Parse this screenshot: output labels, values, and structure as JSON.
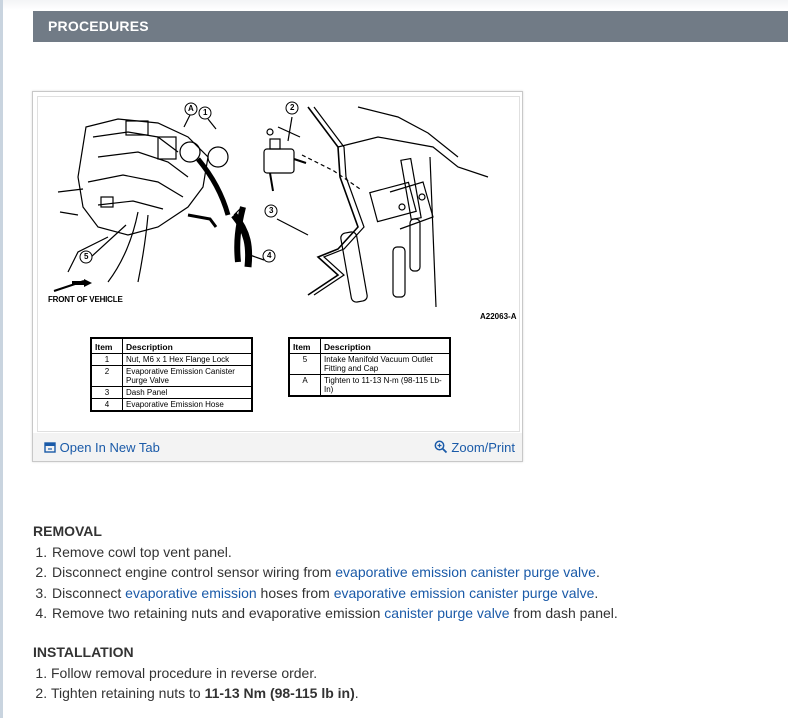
{
  "section": {
    "title": "PROCEDURES"
  },
  "figure": {
    "callouts": {
      "a": "A",
      "one": "1",
      "two": "2",
      "three": "3",
      "four": "4",
      "five": "5"
    },
    "front_label": "FRONT OF VEHICLE",
    "figure_id": "A22063-A",
    "table_left": {
      "headers": [
        "Item",
        "Description"
      ],
      "rows": [
        {
          "item": "1",
          "desc": "Nut, M6 x 1 Hex Flange Lock"
        },
        {
          "item": "2",
          "desc": "Evaporative Emission Canister Purge Valve"
        },
        {
          "item": "3",
          "desc": "Dash Panel"
        },
        {
          "item": "4",
          "desc": "Evaporative Emission Hose"
        }
      ]
    },
    "table_right": {
      "headers": [
        "Item",
        "Description"
      ],
      "rows": [
        {
          "item": "5",
          "desc": "Intake Manifold Vacuum Outlet Fitting and Cap"
        },
        {
          "item": "A",
          "desc": "Tighten to 11-13 N-m (98-115 Lb-In)"
        }
      ]
    },
    "open_new_tab": "Open In New Tab",
    "zoom_print": "Zoom/Print"
  },
  "removal": {
    "heading": "REMOVAL",
    "step1": "Remove cowl top vent panel.",
    "step2_text": "Disconnect engine control sensor wiring from ",
    "step2_link": "evaporative emission canister purge valve",
    "step2_end": ".",
    "step3_text": "Disconnect ",
    "step3_link1": "evaporative emission",
    "step3_mid": " hoses from ",
    "step3_link2": "evaporative emission canister purge valve",
    "step3_end": ".",
    "step4_text": "Remove two retaining nuts and evaporative emission ",
    "step4_link": "canister purge valve",
    "step4_end": " from dash panel."
  },
  "installation": {
    "heading": "INSTALLATION",
    "step1": "Follow removal procedure in reverse order.",
    "step2_text": "Tighten retaining nuts to ",
    "step2_bold": "11-13 Nm (98-115 lb in)",
    "step2_end": "."
  },
  "colors": {
    "header_bg": "#717b86",
    "link": "#1a5aa8",
    "text": "#333333"
  }
}
